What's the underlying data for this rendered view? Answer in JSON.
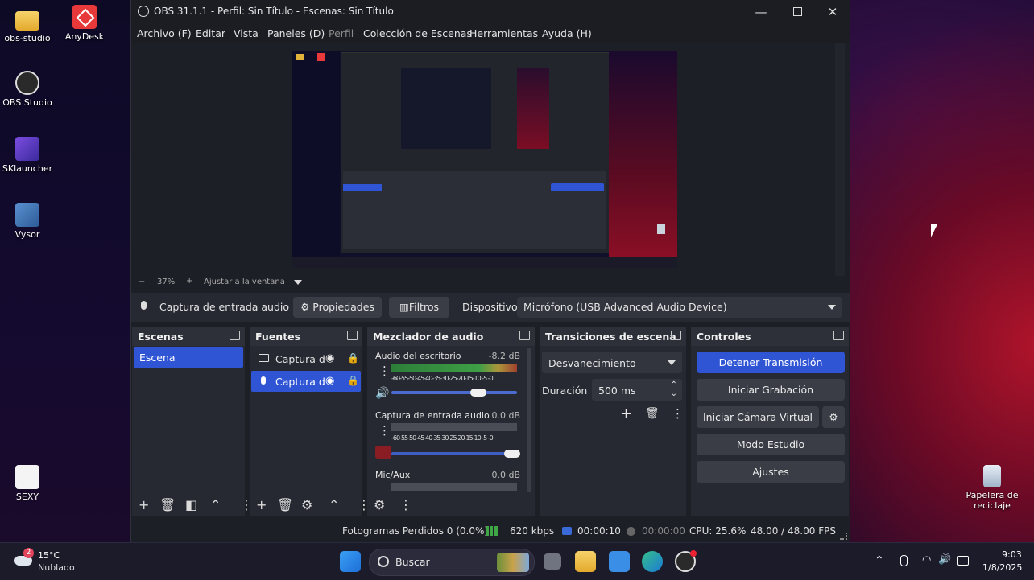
{
  "desktop": {
    "icons_left": [
      {
        "label": "obs-studio",
        "icon": "folder-icon"
      },
      {
        "label": "AnyDesk",
        "icon": "anydesk-icon"
      },
      {
        "label": "OBS Studio",
        "icon": "obs-icon"
      },
      {
        "label": "SKlauncher",
        "icon": "sklauncher-icon"
      },
      {
        "label": "Vysor",
        "icon": "vysor-icon"
      },
      {
        "label": "SEXY",
        "icon": "java-icon"
      }
    ],
    "recycle_bin_line1": "Papelera de",
    "recycle_bin_line2": "reciclaje"
  },
  "window": {
    "title": "OBS 31.1.1 - Perfil: Sin Título - Escenas: Sin Título",
    "menu": [
      "Archivo (F)",
      "Editar",
      "Vista",
      "Paneles (D)",
      "Perfil",
      "Colección de Escenas",
      "Herramientas",
      "Ayuda (H)"
    ]
  },
  "zoom": {
    "minus": "−",
    "value": "37%",
    "plus": "+",
    "fit": "Ajustar a la ventana"
  },
  "source_bar": {
    "source_name": "Captura de entrada audio",
    "properties": "Propiedades",
    "filters": "Filtros",
    "device_label": "Dispositivo",
    "device_value": "Micrófono (USB Advanced Audio Device)"
  },
  "docks": {
    "scenes": {
      "title": "Escenas",
      "items": [
        "Escena"
      ]
    },
    "sources": {
      "title": "Fuentes",
      "items": [
        "Captura d",
        "Captura d"
      ]
    },
    "mixer": {
      "title": "Mezclador de audio",
      "tracks": [
        {
          "name": "Audio del escritorio",
          "db": "-8.2 dB",
          "level": 0.82
        },
        {
          "name": "Captura de entrada audio",
          "db": "0.0 dB",
          "level": 1.0
        },
        {
          "name": "Mic/Aux",
          "db": "0.0 dB",
          "level": 1.0
        }
      ],
      "scale": "-60-55-50-45-40-35-30-25-20-15-10 -5 -0"
    },
    "transitions": {
      "title": "Transiciones de escena",
      "type": "Desvanecimiento",
      "duration_label": "Duración",
      "duration_value": "500 ms"
    },
    "controls": {
      "title": "Controles",
      "stop_stream": "Detener Transmisión",
      "start_recording": "Iniciar Grabación",
      "virtual_cam": "Iniciar Cámara Virtual",
      "studio_mode": "Modo Estudio",
      "settings": "Ajustes"
    }
  },
  "status": {
    "dropped": "Fotogramas Perdidos 0 (0.0%)",
    "bitrate": "620 kbps",
    "stream_time": "00:00:10",
    "rec_time": "00:00:00",
    "cpu": "CPU: 25.6%",
    "fps": "48.00 / 48.00 FPS"
  },
  "taskbar": {
    "weather_temp": "15°C",
    "weather_desc": "Nublado",
    "weather_badge": "2",
    "search": "Buscar",
    "time": "9:03",
    "date": "1/8/2025"
  },
  "colors": {
    "accent": "#2f55d4",
    "window_bg": "#1d1f26",
    "dock_bg": "#262931"
  }
}
